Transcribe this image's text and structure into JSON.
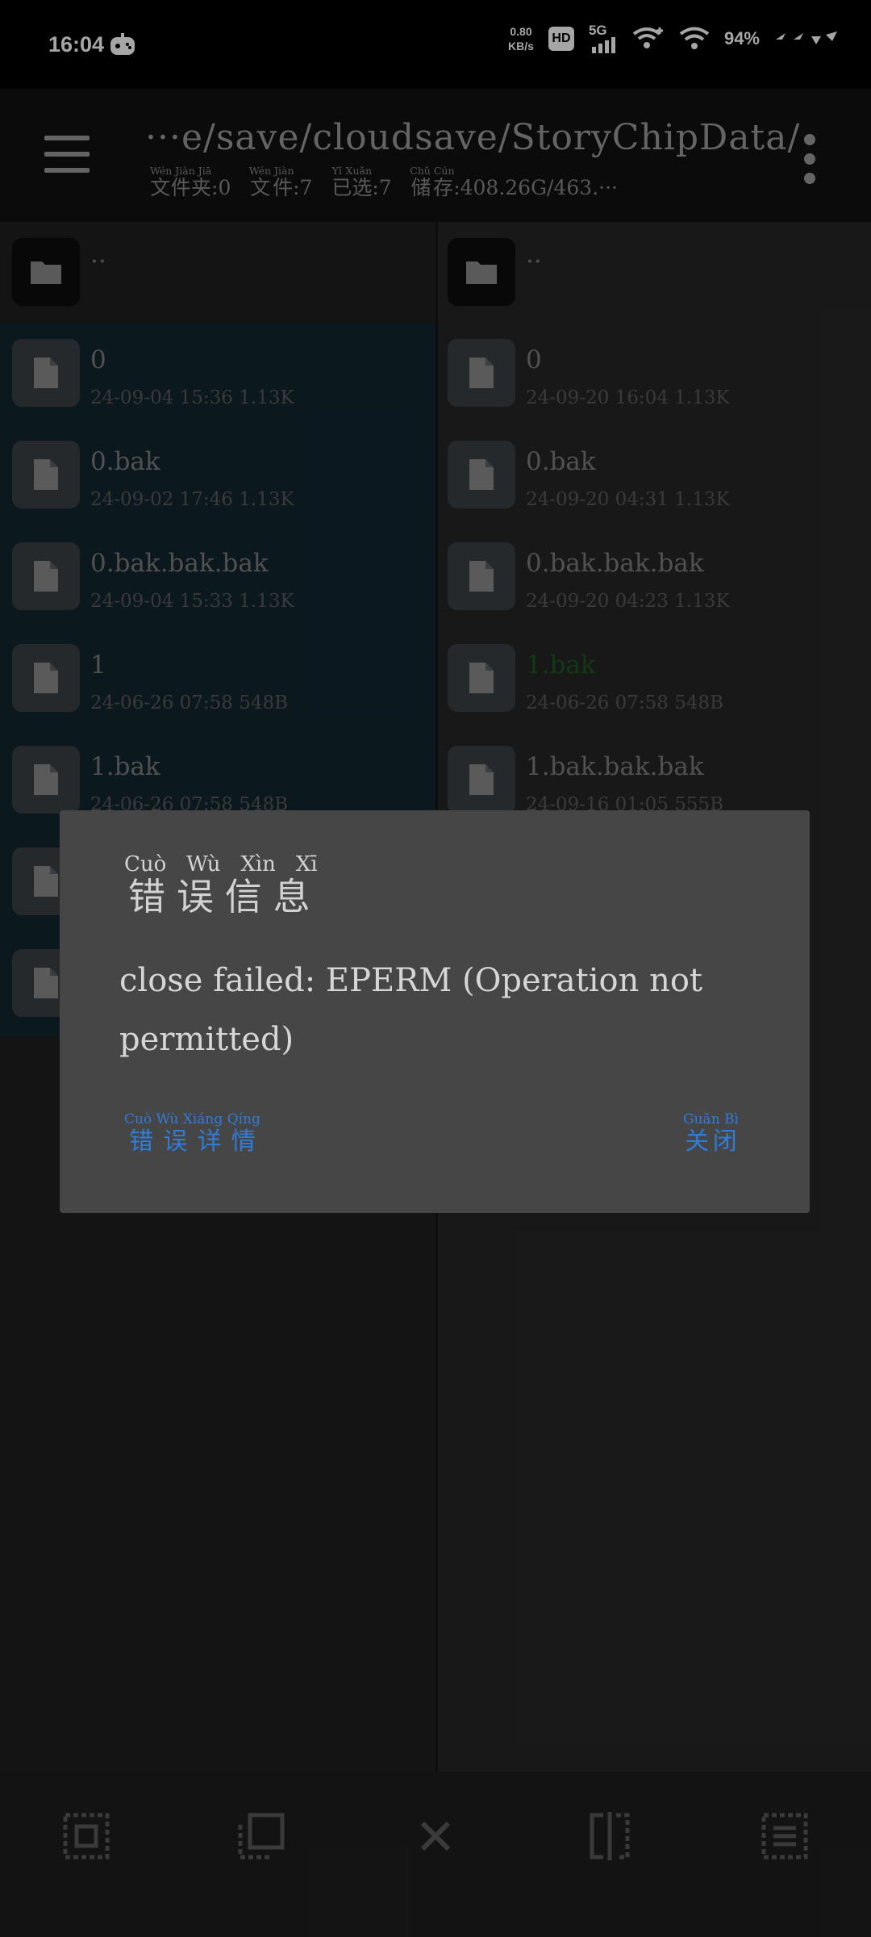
{
  "status": {
    "time": "16:04",
    "net_speed_value": "0.80",
    "net_speed_unit": "KB/s",
    "hd": "HD",
    "network": "5G",
    "battery": "94%"
  },
  "header": {
    "path": "···e/save/cloudsave/StoryChipData/",
    "stats": [
      {
        "label": "文件夹",
        "pinyin": [
          "Wén",
          "Jiàn",
          "Jiā"
        ],
        "value": ":0"
      },
      {
        "label": "文件",
        "pinyin": [
          "Wén",
          "Jiàn"
        ],
        "value": ":7"
      },
      {
        "label": "已选",
        "pinyin": [
          "Yǐ",
          "Xuǎn"
        ],
        "value": ":7"
      },
      {
        "label": "储存",
        "pinyin": [
          "Chǔ",
          "Cún"
        ],
        "value": ":408.26G/463.···"
      }
    ]
  },
  "left_pane": {
    "parent": "..",
    "files": [
      {
        "name": "0",
        "meta": "24-09-04 15:36  1.13K"
      },
      {
        "name": "0.bak",
        "meta": "24-09-02 17:46  1.13K"
      },
      {
        "name": "0.bak.bak.bak",
        "meta": "24-09-04 15:33  1.13K"
      },
      {
        "name": "1",
        "meta": "24-06-26 07:58  548B"
      },
      {
        "name": "1.bak",
        "meta": "24-06-26 07:58  548B"
      }
    ]
  },
  "right_pane": {
    "parent": "..",
    "files": [
      {
        "name": "0",
        "meta": "24-09-20 16:04  1.13K"
      },
      {
        "name": "0.bak",
        "meta": "24-09-20 04:31  1.13K"
      },
      {
        "name": "0.bak.bak.bak",
        "meta": "24-09-20 04:23  1.13K"
      },
      {
        "name": "1.bak",
        "meta": "24-06-26 07:58  548B"
      },
      {
        "name": "1.bak.bak.bak",
        "meta": "24-09-16 01:05  555B"
      }
    ]
  },
  "dialog": {
    "title": "错误信息",
    "title_pinyin": [
      "Cuò",
      "Wù",
      "Xìn",
      "Xī"
    ],
    "message": "close failed: EPERM (Operation not permitted)",
    "details_label": "错误详情",
    "details_pinyin": [
      "Cuò",
      "Wù",
      "Xiáng",
      "Qíng"
    ],
    "close_label": "关闭",
    "close_pinyin": [
      "Guān",
      "Bì"
    ]
  },
  "colors": {
    "accent": "#2f7dd9",
    "selected_bg": "#12252f",
    "dialog_bg": "#464646",
    "highlight_green": "#1d5a1d"
  },
  "bottom_bar": {
    "icons": [
      "select-all-icon",
      "select-range-icon",
      "close-icon",
      "split-view-icon",
      "list-icon"
    ]
  }
}
